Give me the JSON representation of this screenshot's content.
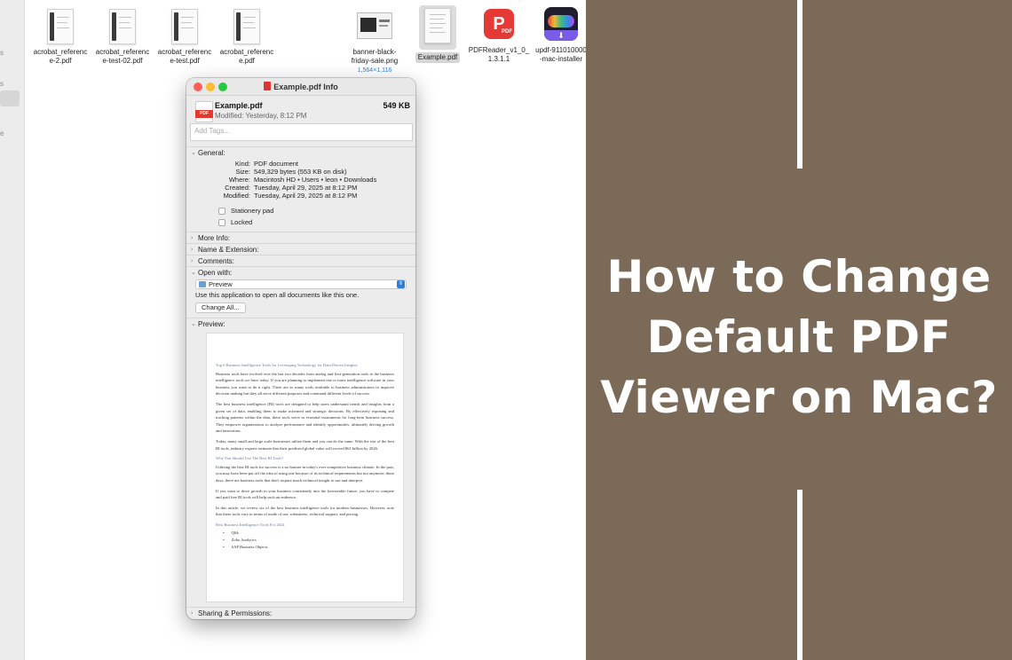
{
  "finder": {
    "files": [
      {
        "name": "acrobat_reference-2.pdf",
        "line1": "acrobat_referenc",
        "line2": "e-2.pdf"
      },
      {
        "name": "acrobat_reference-test-02.pdf",
        "line1": "acrobat_referenc",
        "line2": "e-test-02.pdf"
      },
      {
        "name": "acrobat_reference-test.pdf",
        "line1": "acrobat_referenc",
        "line2": "e-test.pdf"
      },
      {
        "name": "acrobat_reference.pdf",
        "line1": "acrobat_referenc",
        "line2": "e.pdf"
      },
      {
        "name": "banner-black-friday-sale.png",
        "line1": "banner-black-",
        "line2": "friday-sale.png",
        "sub": "1,564×1,116"
      },
      {
        "name": "Example.pdf",
        "line1": "Example.pdf"
      },
      {
        "name": "PDFReader_v1_0_1.3.1.1",
        "line1": "PDFReader_v1_0_",
        "line2": "1.3.1.1",
        "icon_text": "P",
        "icon_tag": "PDF"
      },
      {
        "name": "updf-911010000-mac-installer",
        "line1": "updf-911010000",
        "line2": "-mac-installer"
      }
    ],
    "sidebar_fragments": [
      "s",
      "s",
      "e"
    ]
  },
  "info": {
    "window_title": "Example.pdf Info",
    "file_name": "Example.pdf",
    "file_size": "549 KB",
    "modified_short": "Modified: Yesterday, 8:12 PM",
    "pdf_badge": "PDF",
    "tags_placeholder": "Add Tags...",
    "general": {
      "title": "General:",
      "kind_k": "Kind:",
      "kind_v": "PDF document",
      "size_k": "Size:",
      "size_v": "549,329 bytes (553 KB on disk)",
      "where_k": "Where:",
      "where_v": "Macintosh HD • Users • leon • Downloads",
      "created_k": "Created:",
      "created_v": "Tuesday, April 29, 2025 at 8:12 PM",
      "modified_k": "Modified:",
      "modified_v": "Tuesday, April 29, 2025 at 8:12 PM",
      "stationery": "Stationery pad",
      "locked": "Locked"
    },
    "more_info": "More Info:",
    "name_ext": "Name & Extension:",
    "comments": "Comments:",
    "open_with": {
      "title": "Open with:",
      "app": "Preview",
      "help": "Use this application to open all documents like this one.",
      "change_all": "Change All..."
    },
    "preview_title": "Preview:",
    "sharing": "Sharing & Permissions:"
  },
  "preview_doc": {
    "title": "Top 6 Business Intelligence Tools for Leveraging Technology for Data-Driven Insights",
    "p1": "Business tools have evolved over the last two decades from analog and first-generation tools to the business intelligence tools we have today.  If you are planning to implement one or more intelligence software in your business you want to do it right. There are so many tools available to business administrators to improve decision making but they all serve different purposes and command different levels of success.",
    "p2": "The best business intelligence (BI) tools are designed to help users understand trends and insights from a given set of data, enabling them to make informed and strategic decisions. By effectively exposing and tracking patterns within the data, these tools serve as essential instruments for long-term business success. They empower organizations to analyze performance and identify opportunities, ultimately driving growth and innovation.",
    "p3": "Today, many small and large scale businesses utilize them and you can do the same. With the rise of the best BI tools, industry experts estimate that their predicted global value will exceed $61 billion by 2026.",
    "h2": "Why You Should Use The Best BI Tools?",
    "p4": "Utilizing the best BI tools for success is a no brainer in today's ever competitive business climate. In the past, you may have been put off the idea of using one because of its technical requirements but not anymore; these days, there are business tools that don't require much technical insight to use and interpret.",
    "p5": "If you want to drive growth in your business consistently into the foreseeable future, you have to compete and paid free BI tools will help such an endeavor.",
    "p6": "In this article, we review six of the best business intelligence tools for modern businesses. However, note that these tools vary in terms of mode of use, robustness, technical support, and pricing.",
    "h3": "Best Business Intelligence Tools For 2024",
    "list": [
      "Qlik",
      "Zoho Analytics",
      "SAP Business Objects"
    ]
  },
  "panel": {
    "headline_1": "How to Change",
    "headline_2": "Default PDF",
    "headline_3": "Viewer on Mac?",
    "bg_color": "#7a6a57"
  }
}
